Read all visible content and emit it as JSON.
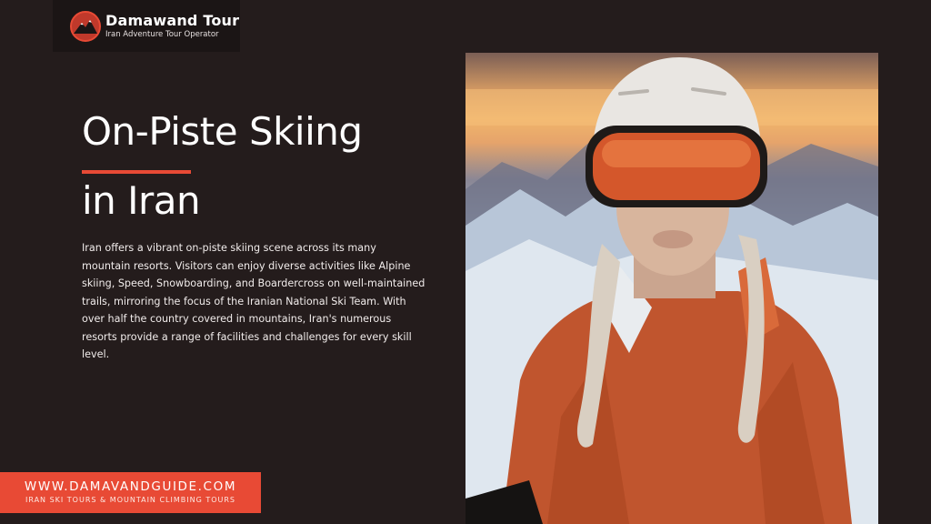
{
  "logo": {
    "name": "Damawand Tour",
    "tagline": "Iran Adventure Tour Operator",
    "icon": "mountain-logo-icon",
    "accent_color": "#e84a35"
  },
  "hero": {
    "title_line1": "On-Piste Skiing",
    "title_line2": "in Iran",
    "body": "Iran offers a vibrant on-piste skiing scene across its many mountain resorts. Visitors can enjoy diverse activities like Alpine skiing, Speed, Snowboarding, and Boardercross on well-maintained trails, mirroring the focus of the Iranian National Ski Team. With over half the country covered in mountains, Iran's numerous resorts provide a range of facilities and challenges for every skill level."
  },
  "photo": {
    "subject": "skier-portrait-photo"
  },
  "footer": {
    "url": "WWW.DAMAVANDGUIDE.COM",
    "tagline": "IRAN SKI TOURS & MOUNTAIN CLIMBING TOURS"
  },
  "colors": {
    "background": "#241c1c",
    "accent": "#e84a35",
    "text": "#ffffff"
  }
}
